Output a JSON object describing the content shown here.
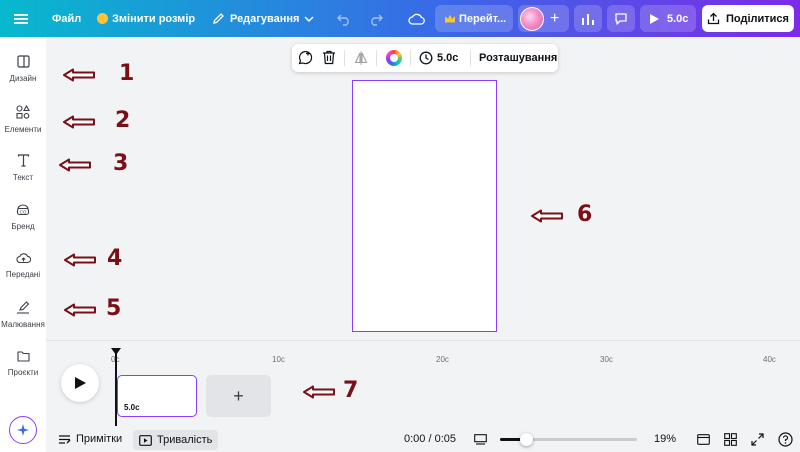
{
  "topbar": {
    "file_label": "Файл",
    "resize_label": "Змінити розмір",
    "editing_label": "Редагування",
    "upgrade_label": "Перейт...",
    "duration_label": "5.0с",
    "share_label": "Поділитися"
  },
  "sidebar": {
    "items": [
      {
        "label": "Дизайн",
        "icon": "design-icon"
      },
      {
        "label": "Елементи",
        "icon": "elements-icon"
      },
      {
        "label": "Текст",
        "icon": "text-icon"
      },
      {
        "label": "Бренд",
        "icon": "brand-icon"
      },
      {
        "label": "Передані",
        "icon": "uploads-icon"
      },
      {
        "label": "Малювання",
        "icon": "draw-icon"
      },
      {
        "label": "Проєкти",
        "icon": "projects-icon"
      }
    ]
  },
  "floatbar": {
    "duration": "5.0с",
    "position_label": "Розташування"
  },
  "timeline": {
    "ticks": [
      "0с",
      "10с",
      "20с",
      "30с",
      "40с"
    ],
    "clip_duration": "5.0с"
  },
  "bottombar": {
    "notes_label": "Примітки",
    "duration_label": "Тривалість",
    "time_readout": "0:00 / 0:05",
    "zoom": "19%",
    "zoom_fraction": 0.19
  },
  "annotations": [
    "1",
    "2",
    "3",
    "4",
    "5",
    "6",
    "7"
  ],
  "colors": {
    "accent": "#8b3dff",
    "annotation": "#7a0f16",
    "topbar_start": "#07b9ce",
    "topbar_end": "#7d2ae8"
  }
}
